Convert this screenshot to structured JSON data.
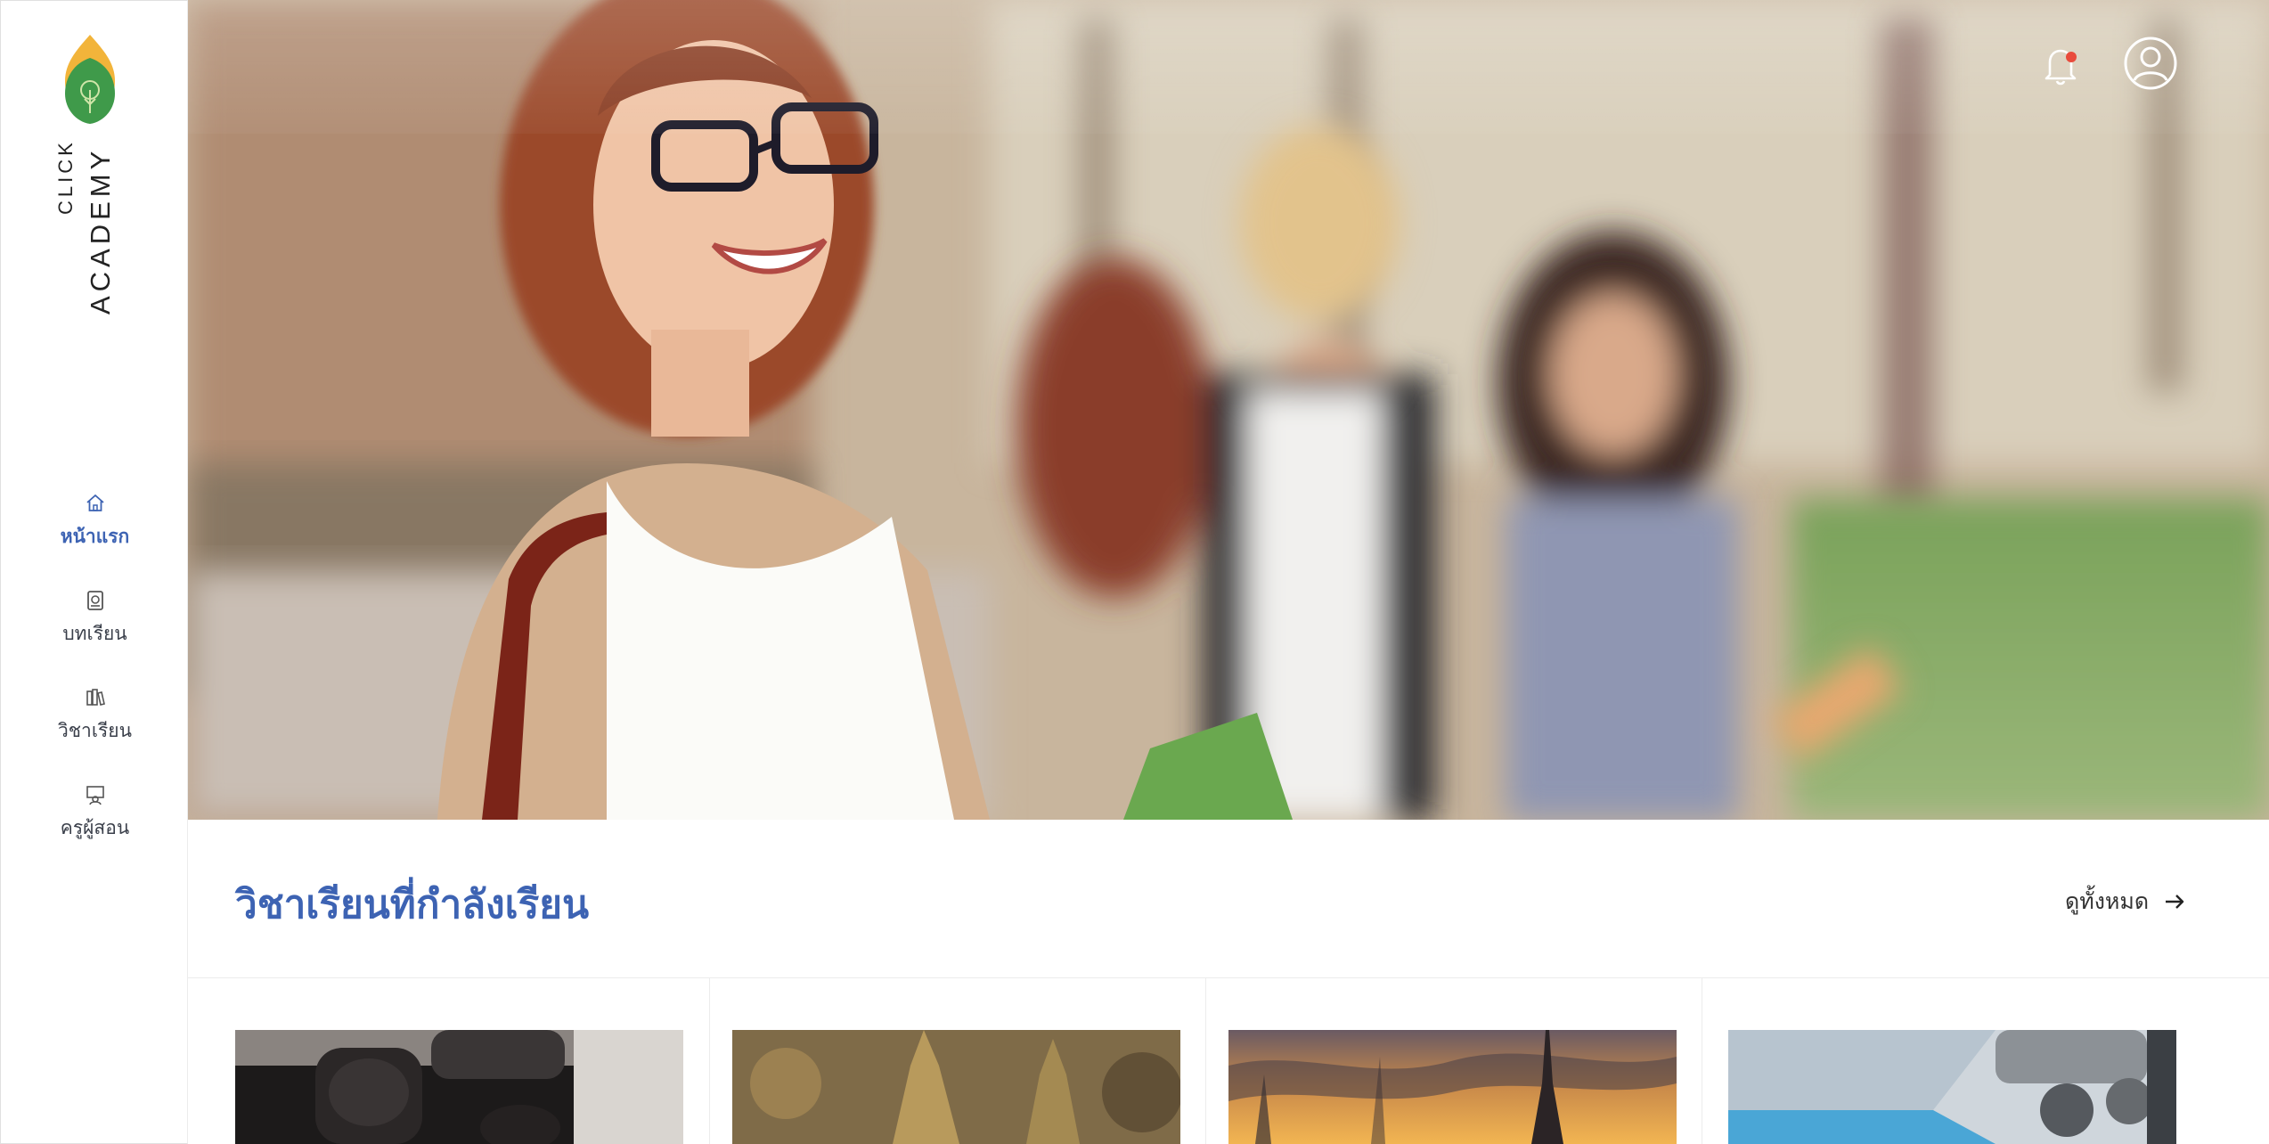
{
  "logo": {
    "line1": "CLICK",
    "line2": "ACADEMY"
  },
  "sidebar": {
    "items": [
      {
        "label": "หน้าแรก",
        "icon": "home-icon",
        "active": true
      },
      {
        "label": "บทเรียน",
        "icon": "lesson-icon",
        "active": false
      },
      {
        "label": "วิชาเรียน",
        "icon": "subject-icon",
        "active": false
      },
      {
        "label": "ครูผู้สอน",
        "icon": "teacher-icon",
        "active": false
      }
    ]
  },
  "header": {
    "notification_icon": "bell-icon",
    "notification_dot_color": "#e94b3c",
    "profile_icon": "user-circle-icon"
  },
  "section": {
    "title": "วิชาเรียนที่กำลังเรียน",
    "see_all_label": "ดูทั้งหมด",
    "see_all_icon": "arrow-right-icon"
  },
  "courses": [
    {
      "thumb_icon": "microscope-thumbnail"
    },
    {
      "thumb_icon": "temple-thumbnail"
    },
    {
      "thumb_icon": "eiffel-tower-thumbnail"
    },
    {
      "thumb_icon": "microscope-blue-thumbnail"
    }
  ],
  "colors": {
    "accent": "#3d63b3",
    "logo_yellow": "#f2b43a",
    "logo_green": "#3f9a4a"
  }
}
